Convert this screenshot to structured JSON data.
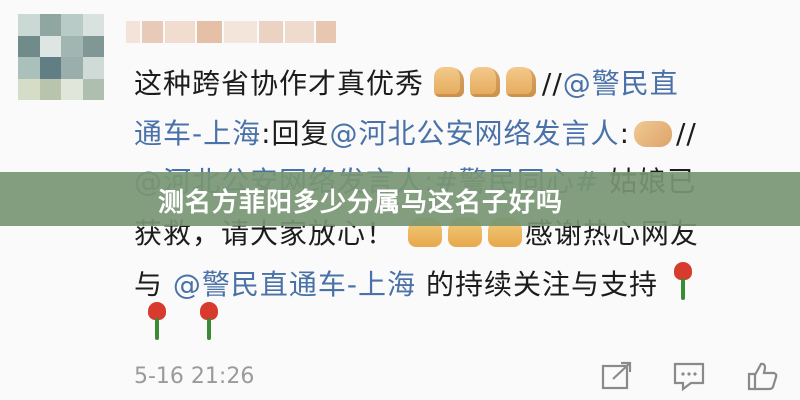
{
  "comment": {
    "text_line_1": "这种跨省协作才真优秀",
    "separator_1": "//",
    "mention_1": "@警民直",
    "mention_1_cont": "通车-上海",
    "reply_label": ":回复",
    "mention_2": "@河北公安网络发言人",
    "colon": ":",
    "separator_2": "//",
    "mention_3": "@河北公安网络发言人",
    "hashtag": ":#警民同心#",
    "text_line_3": "姑娘已",
    "text_line_4a": "获救，请大家放心！",
    "text_line_4b": "感谢热心网友",
    "text_line_5a": "与",
    "mention_4": "@警民直通车-上海",
    "text_line_5b": "的持续关注与支持",
    "timestamp": "5-16 21:26"
  },
  "banner": {
    "title": "测名方菲阳多少分属马这名子好吗"
  },
  "icons": {
    "avatar": "pixelated-avatar",
    "username": "blurred-username",
    "thumbs_up": "thumbs-up-emoji",
    "handshake": "handshake-emoji",
    "pray": "pray-emoji",
    "rose": "rose-emoji",
    "share": "share-icon",
    "comment": "comment-icon",
    "like": "like-icon"
  },
  "colors": {
    "mention": "#4a72a8",
    "banner": "#789673",
    "text": "#1c1c1c"
  }
}
